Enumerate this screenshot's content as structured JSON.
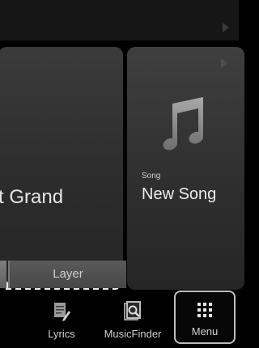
{
  "voice": {
    "name": "t Grand"
  },
  "layer": {
    "label": "Layer"
  },
  "song": {
    "caption": "Song",
    "name": "New Song"
  },
  "bottom": {
    "lyrics_label": "Lyrics",
    "musicfinder_label": "MusicFinder",
    "menu_label": "Menu"
  },
  "colors": {
    "background": "#000000",
    "panel": "#333333",
    "text": "#e6e6e6"
  },
  "icons": [
    "play-triangle-icon",
    "music-note-icon",
    "lyrics-icon",
    "musicfinder-icon",
    "menu-grid-icon"
  ]
}
